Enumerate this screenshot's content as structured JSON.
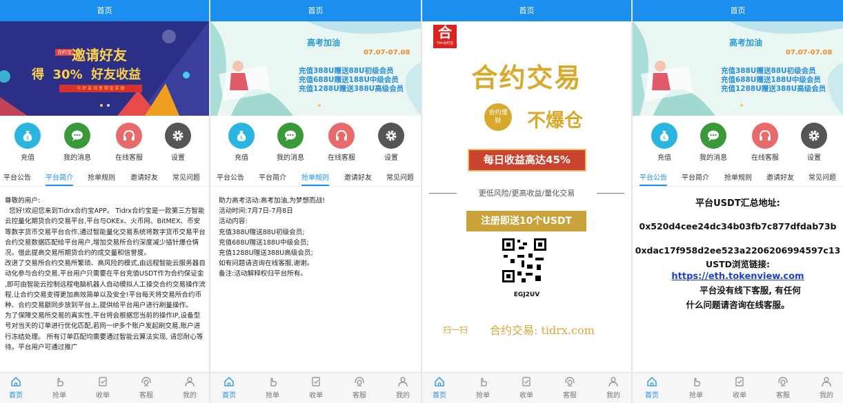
{
  "header_title": "首页",
  "icons": [
    "充值",
    "我的消息",
    "在线客服",
    "设置"
  ],
  "icon_names": [
    "money-bag-icon",
    "chat-icon",
    "headset-icon",
    "gear-icon"
  ],
  "tabs": [
    "平台公告",
    "平台简介",
    "抢单规则",
    "邀请好友",
    "常见问题"
  ],
  "bottom_nav": [
    "首页",
    "抢单",
    "收单",
    "客服",
    "我的"
  ],
  "colors": {
    "header": "#1a8ff0",
    "recharge": "#2ab4e0",
    "message": "#3a9a3a",
    "service": "#e86a6a",
    "settings": "#555555"
  },
  "banner1": {
    "badge": "合约宝",
    "line1": "邀请好友",
    "line2": "得  30%  好友收益",
    "line3": "与 好 友 共 享 佣 金 奖 励"
  },
  "banner2": {
    "title": "高考加油",
    "date": "07.07-07.08",
    "lines": [
      "充值388U赠送88U初级会员",
      "充值688U赠送188U中级会员",
      "充值1288U赠送388U高级会员"
    ]
  },
  "panel1": {
    "paragraphs": [
      "尊敬的用户:",
      "  您好!欢迎您来到Tidrx合约宝APP。 Tidrx合约宝是一款第三方智能云控量化期货合约交易平台,平台与OKEx、火币网、BitMEX、币安等数字货币交易平台合作,通过智能量化交易系统将数字货币交易平台合约交易数据匹配给平台用户,增加交易所合约深度减少插针爆仓情况。借此提高交易所期货合约的成交量和信誉度。",
      "改进了交易所合约交易所繁琐、高风险的模式,由远程智能云服务器自动化参与合约交易,平台用户只需要在平台充值USDT作为合约保证金 ,即可由智能云控制远程电脑机器人自动模拟人工操交合约交易操作流程,让合约交易变得更加高效简单以及安全!平台每天将交易所合约币种、合约交易额同步放到平台上,提供给平台用户进行刷量操作。",
      "为了保障交易所交易的真实性,平台将会根据您当前的操作IP,设备型号对当天的订单进行优化匹配,若同一IP多个账户发起刷交易,账户进行冻结处理。 所有订单匹配均需要通过智能云算法实现, 请您耐心等待。平台用户可通过推广"
    ]
  },
  "panel2": {
    "lines": [
      "助力高考活动:高考加油,为梦想而战!",
      "活动时间:7月7日-7月8日",
      "活动内容:",
      "充值388U赠送88U初级会员;",
      "充值688U赠送188U中级会员;",
      "充值1288U赠送388U高级会员;",
      "如有问题请咨询在线客服,谢谢。",
      "备注:活动解释权归平台所有。"
    ]
  },
  "panel3": {
    "logo": "合",
    "logo_sub": "Tidr合约宝",
    "title": "合约交易",
    "circle": "合约理财",
    "no_liq": "不爆仓",
    "daily": "每日收益高达45%",
    "slogan": "更低风险/更高收益/量化交易",
    "register": "注册即送10个USDT",
    "code": "EGJ2UV",
    "scan": "扫一扫",
    "site": "合约交易: tidrx.com"
  },
  "panel4": {
    "title": "平台USDT汇总地址:",
    "addr1": "0x520d4cee24dc34b03fb7c877dfdab73b",
    "addr2": "0xdac17f958d2ee523a2206206994597c13",
    "browser_label": "USTD浏览链接:",
    "link": "https://eth.tokenview.com",
    "note1": "平台没有线下客服, 有任何",
    "note2": "什么问题请咨询在线客服。"
  }
}
